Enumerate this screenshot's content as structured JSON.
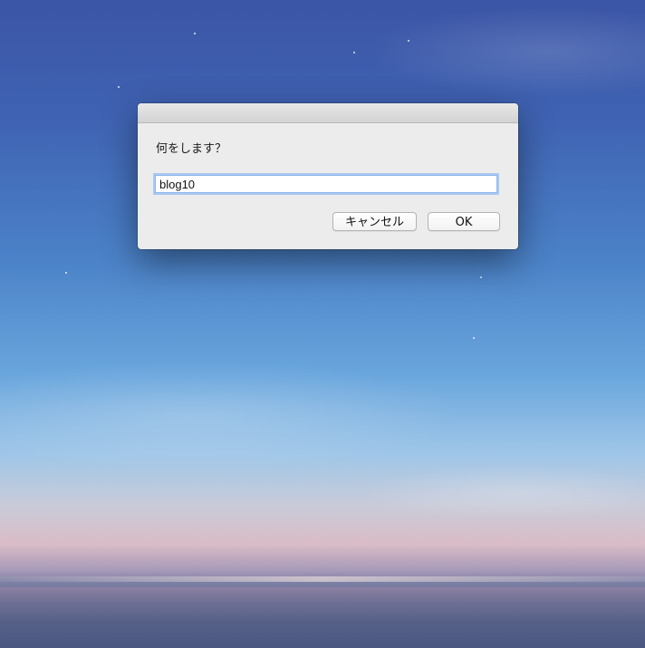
{
  "dialog": {
    "prompt": "何をします？",
    "input_value": "blog10",
    "cancel_label": "キャンセル",
    "ok_label": "OK"
  },
  "colors": {
    "dialog_background": "#ececec",
    "input_focus_ring": "#a9c9f3"
  }
}
